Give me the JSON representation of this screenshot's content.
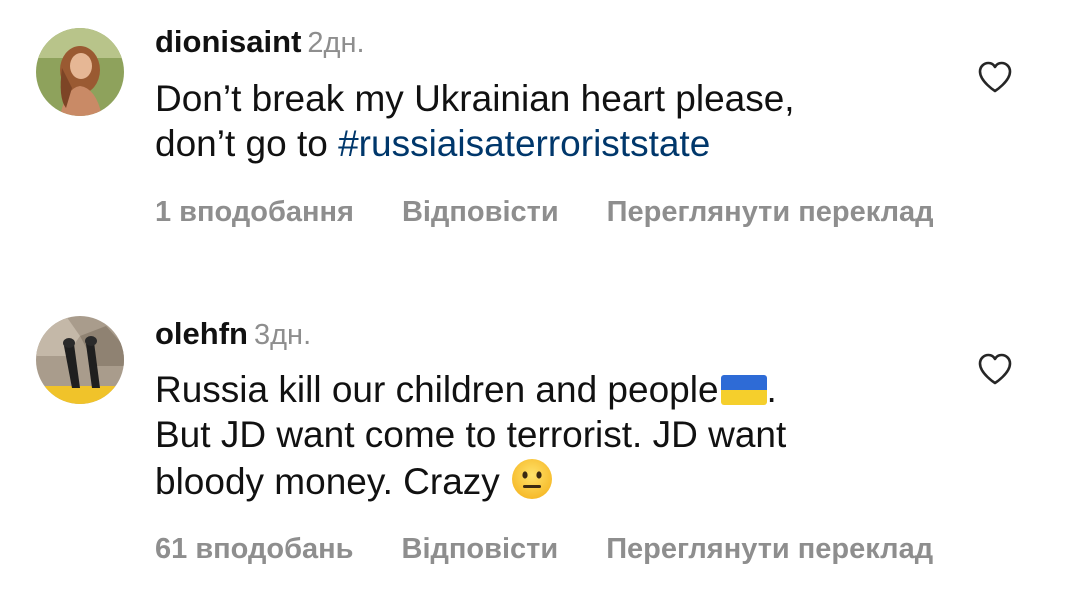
{
  "comments": [
    {
      "username": "dionisaint",
      "time": "2дн.",
      "avatar": "avatar-woman-icon",
      "line1": "Don’t break my Ukrainian heart please,",
      "line2_prefix": "don’t go to ",
      "hashtag": "#russiaisaterroriststate",
      "likes": "1 вподобання",
      "reply": "Відповісти",
      "translate": "Переглянути переклад"
    },
    {
      "username": "olehfn",
      "time": "3дн.",
      "avatar": "avatar-feet-icon",
      "line1": "Russia kill our children and people",
      "line1_suffix": ".",
      "line2": "But JD want come to terrorist. JD want",
      "line3": "bloody money. Crazy",
      "likes": "61 вподобань",
      "reply": "Відповісти",
      "translate": "Переглянути переклад"
    }
  ],
  "icons": {
    "like": "heart-outline-icon",
    "flag": "ukraine-flag-icon",
    "emoji": "neutral-face-icon"
  },
  "colors": {
    "text": "#111111",
    "secondary": "#8e8e8e",
    "hashtag": "#00376b",
    "flag_blue": "#2e6bd6",
    "flag_yellow": "#f5cf2c"
  }
}
